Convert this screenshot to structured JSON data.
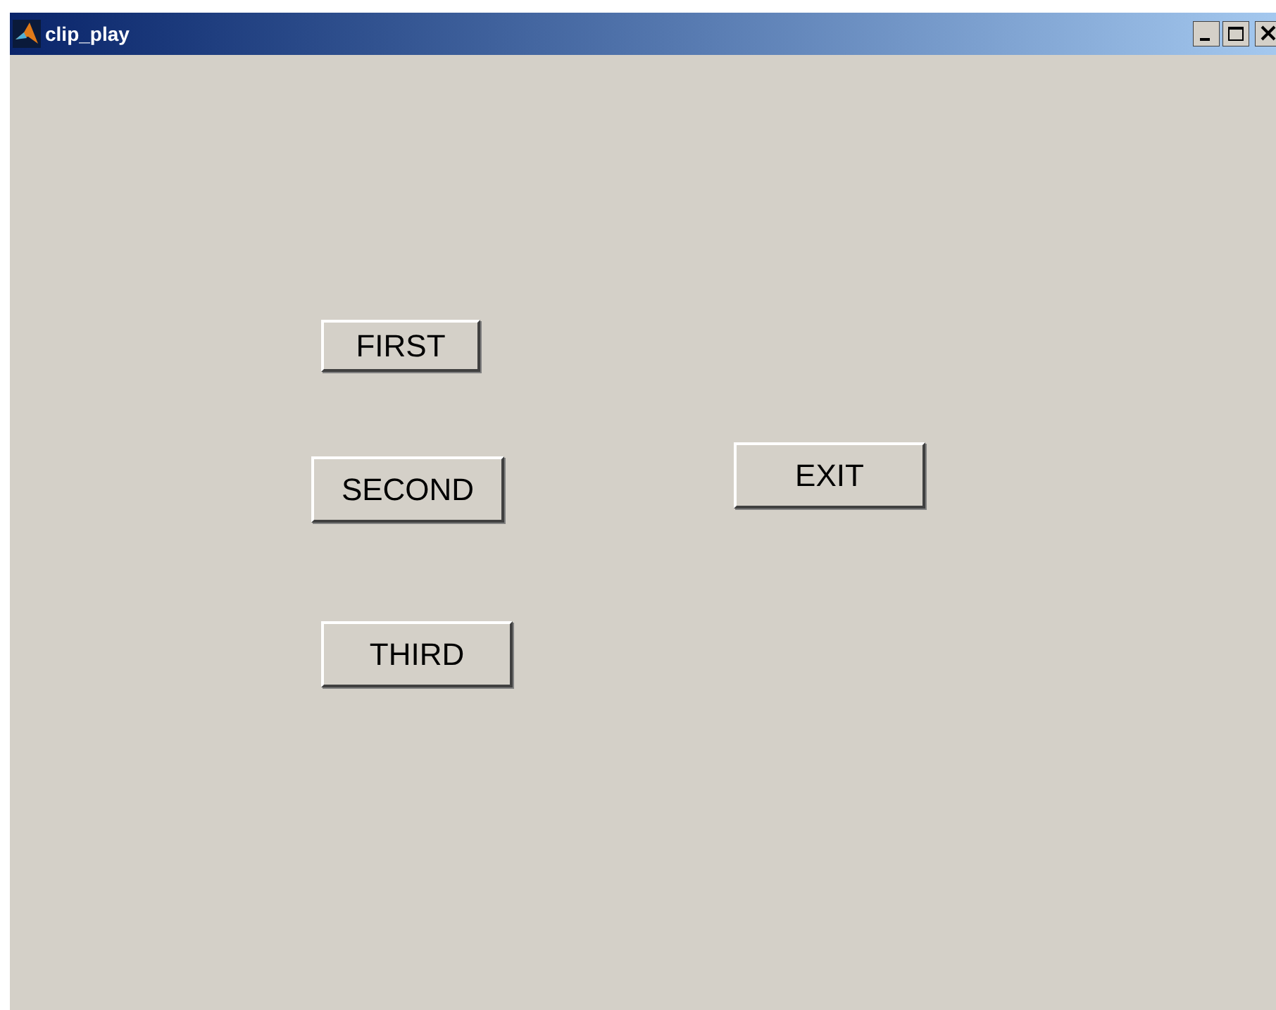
{
  "window": {
    "title": "clip_play"
  },
  "buttons": [
    {
      "label": "FIRST",
      "kind": "push"
    },
    {
      "label": "SECOND",
      "kind": "push"
    },
    {
      "label": "THIRD",
      "kind": "push"
    },
    {
      "label": "EXIT",
      "kind": "push"
    }
  ]
}
